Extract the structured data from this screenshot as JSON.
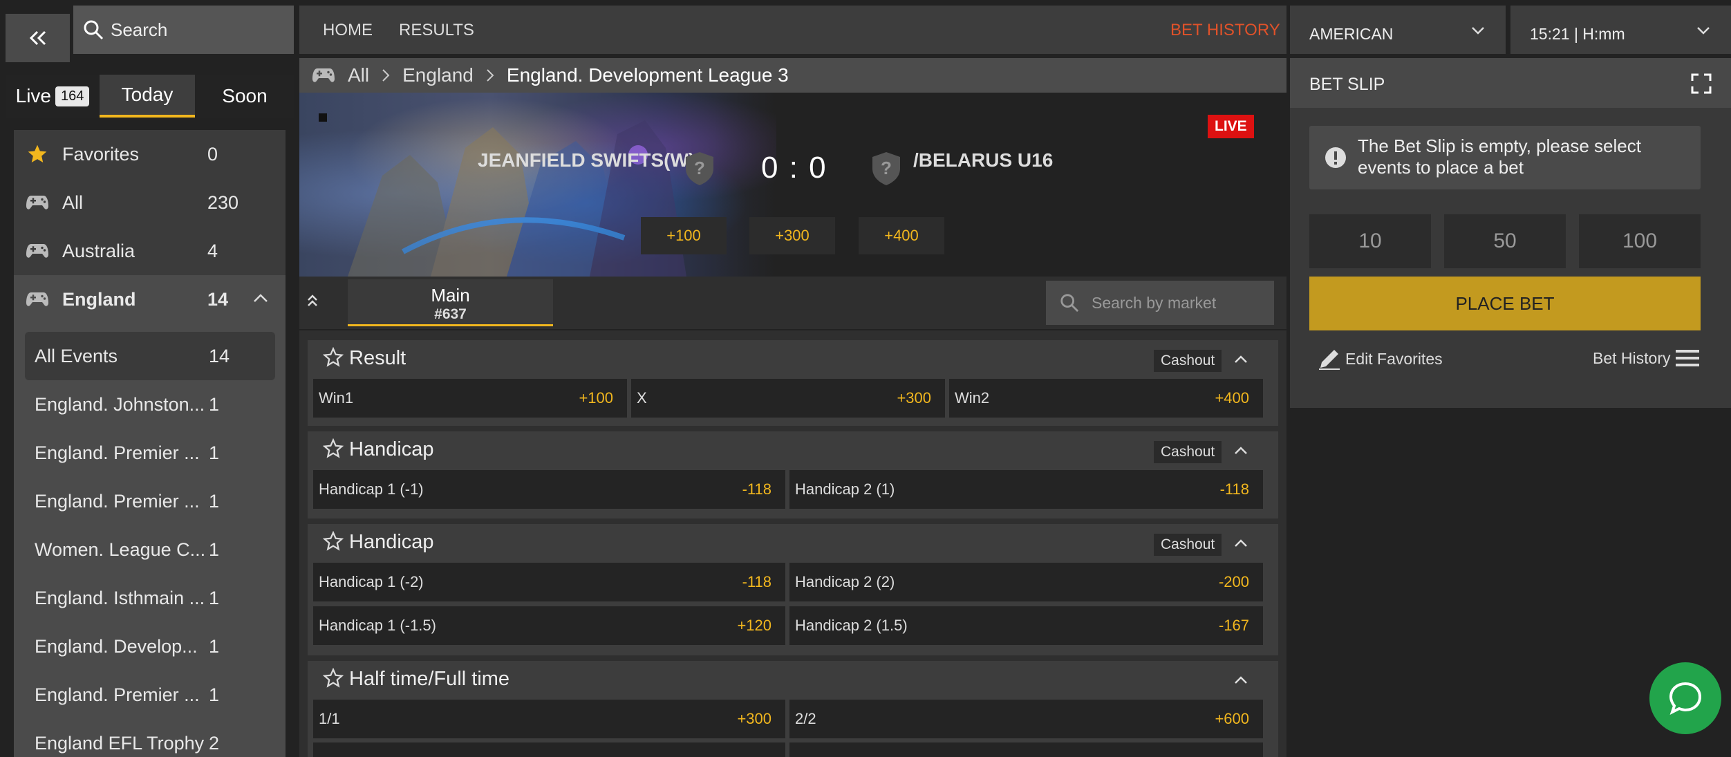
{
  "sidebar": {
    "search_label": "Search",
    "tabs": [
      {
        "label": "Live",
        "badge": "164"
      },
      {
        "label": "Today"
      },
      {
        "label": "Soon"
      }
    ],
    "items": [
      {
        "label": "Favorites",
        "count": "0"
      },
      {
        "label": "All",
        "count": "230"
      },
      {
        "label": "Australia",
        "count": "4"
      },
      {
        "label": "England",
        "count": "14"
      }
    ],
    "sub_items": [
      {
        "label": "All Events",
        "count": "14"
      },
      {
        "label": "England. Johnston...",
        "count": "1"
      },
      {
        "label": "England. Premier ...",
        "count": "1"
      },
      {
        "label": "England. Premier ...",
        "count": "1"
      },
      {
        "label": "Women. League C...",
        "count": "1"
      },
      {
        "label": "England. Isthmain ...",
        "count": "1"
      },
      {
        "label": "England. Develop...",
        "count": "1"
      },
      {
        "label": "England. Premier ...",
        "count": "1"
      },
      {
        "label": "England EFL Trophy",
        "count": "2"
      }
    ]
  },
  "nav": {
    "home": "HOME",
    "results": "RESULTS",
    "bet_history": "BET HISTORY"
  },
  "odds_format": "AMERICAN",
  "time_format": "15:21 | H:mm",
  "breadcrumb": [
    "All",
    "England",
    "England. Development League 3"
  ],
  "event": {
    "team1": "JEANFIELD SWIFTS(W)",
    "team2": "/BELARUS U16",
    "score": "0 : 0",
    "live": "LIVE",
    "odds": [
      "+100",
      "+300",
      "+400"
    ]
  },
  "market_tab": {
    "label": "Main",
    "id": "#637"
  },
  "market_search_placeholder": "Search by market",
  "markets": [
    {
      "title": "Result",
      "cashout": "Cashout",
      "rows": [
        [
          {
            "l": "Win1",
            "v": "+100"
          },
          {
            "l": "X",
            "v": "+300"
          },
          {
            "l": "Win2",
            "v": "+400"
          }
        ]
      ]
    },
    {
      "title": "Handicap",
      "cashout": "Cashout",
      "rows": [
        [
          {
            "l": "Handicap 1 (-1)",
            "v": "-118"
          },
          {
            "l": "Handicap 2 (1)",
            "v": "-118"
          }
        ]
      ]
    },
    {
      "title": "Handicap",
      "cashout": "Cashout",
      "rows": [
        [
          {
            "l": "Handicap 1 (-2)",
            "v": "-118"
          },
          {
            "l": "Handicap 2 (2)",
            "v": "-200"
          }
        ],
        [
          {
            "l": "Handicap 1 (-1.5)",
            "v": "+120"
          },
          {
            "l": "Handicap 2 (1.5)",
            "v": "-167"
          }
        ]
      ]
    },
    {
      "title": "Half time/Full time",
      "rows": [
        [
          {
            "l": "1/1",
            "v": "+300"
          },
          {
            "l": "2/2",
            "v": "+600"
          }
        ]
      ]
    }
  ],
  "betslip": {
    "title": "BET SLIP",
    "empty_msg": "The Bet Slip is empty, please select events to place a bet",
    "stakes": [
      "10",
      "50",
      "100"
    ],
    "place_bet": "PLACE BET",
    "edit_favorites": "Edit Favorites",
    "bet_history": "Bet History"
  },
  "colors": {
    "accent": "#f2b71e",
    "live": "#dd1111",
    "nav_bet_history": "#e0522a",
    "chat": "#22a44b",
    "place_bet": "#c39a1f"
  }
}
